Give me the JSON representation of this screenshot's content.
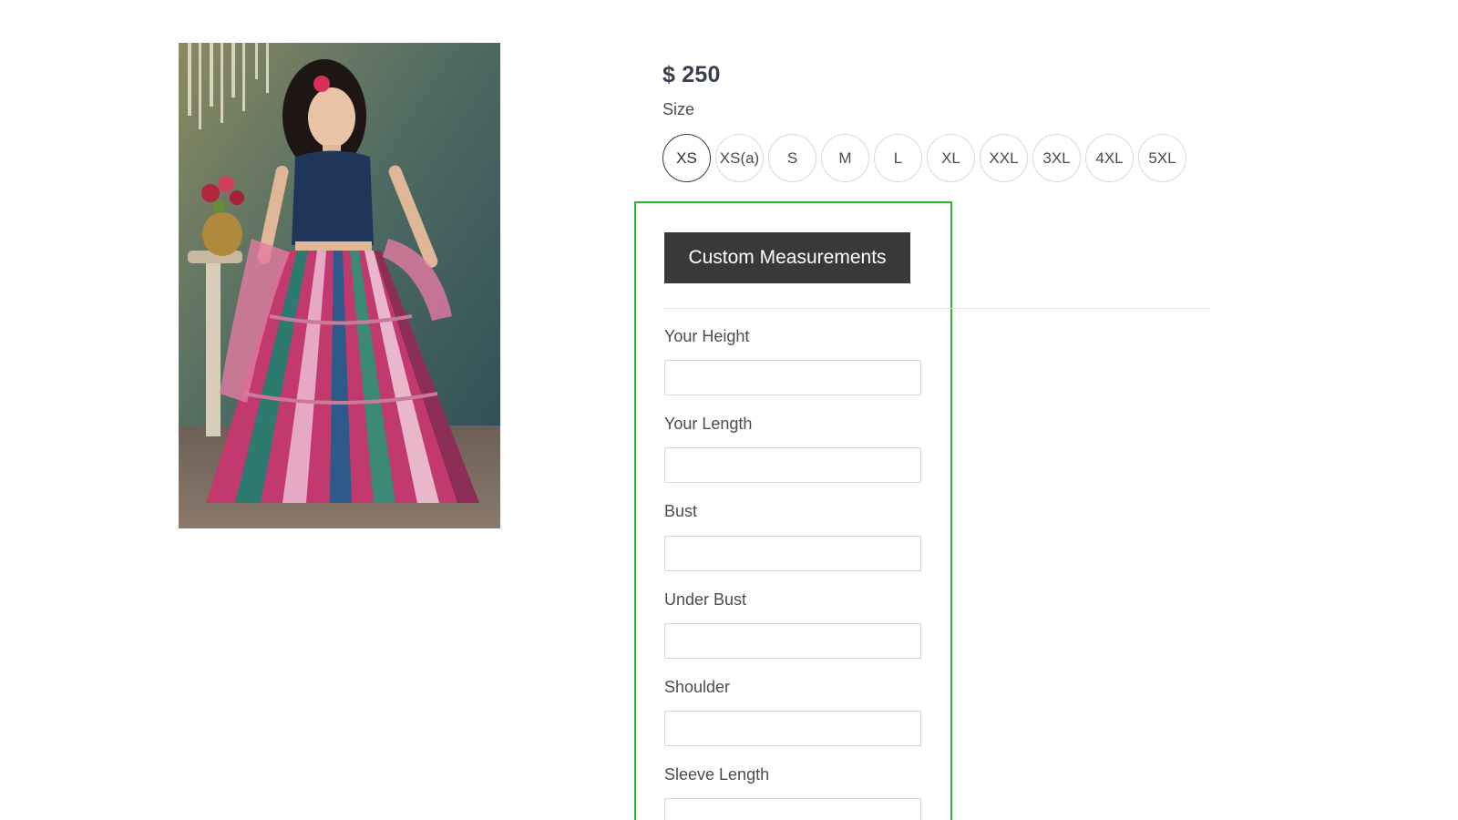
{
  "product": {
    "price": "$ 250",
    "size_label": "Size",
    "sizes": [
      "XS",
      "XS(a)",
      "S",
      "M",
      "L",
      "XL",
      "XXL",
      "3XL",
      "4XL",
      "5XL"
    ],
    "selected_size": "XS"
  },
  "custom_measurements": {
    "button_label": "Custom Measurements",
    "fields": [
      {
        "label": "Your Height",
        "value": "",
        "placeholder": ""
      },
      {
        "label": "Your Length",
        "value": "",
        "placeholder": ""
      },
      {
        "label": "Bust",
        "value": "",
        "placeholder": ""
      },
      {
        "label": "Under Bust",
        "value": "",
        "placeholder": ""
      },
      {
        "label": "Shoulder",
        "value": "",
        "placeholder": ""
      },
      {
        "label": "Sleeve Length",
        "value": "",
        "placeholder": ""
      }
    ]
  },
  "colors": {
    "highlight": "#2ab534",
    "button_bg": "#3b3839",
    "text": "#3d3d4e"
  }
}
